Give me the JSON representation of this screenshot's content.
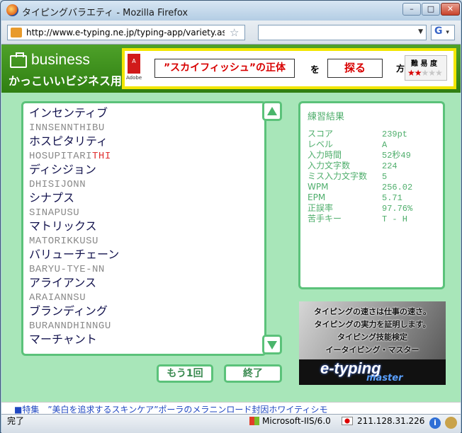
{
  "window": {
    "title": "タイピングバラエティ - Mozilla Firefox",
    "min": "–",
    "max": "□",
    "close": "✕"
  },
  "nav": {
    "url": "http://www.e-typing.ne.jp/typing-app/variety.asp",
    "star": "☆",
    "search_value": "",
    "search_engine": "G"
  },
  "banner": {
    "title": "business",
    "subtitle": "かっこいいビジネス用語",
    "ad": {
      "brand": "Adobe",
      "brand_mark": "A",
      "phrase": "”スカイフィッシュ”の正体",
      "particle": "を",
      "action": "探る",
      "method": "方法",
      "difficulty_label": "難 易 度",
      "stars_on": "★★",
      "stars_off": "★★★"
    }
  },
  "words": [
    {
      "kana": "インセンティブ",
      "roma": "INNSENNTHIBU",
      "err": ""
    },
    {
      "kana": "ホスピタリティ",
      "roma": "HOSUPITARI",
      "err": "THI"
    },
    {
      "kana": "ディシジョン",
      "roma": "DHISIJONN",
      "err": ""
    },
    {
      "kana": "シナプス",
      "roma": "SINAPUSU",
      "err": ""
    },
    {
      "kana": "マトリックス",
      "roma": "MATORIKKUSU",
      "err": ""
    },
    {
      "kana": "バリューチェーン",
      "roma": "BARYU-TYE-NN",
      "err": ""
    },
    {
      "kana": "アライアンス",
      "roma": "ARAIANNSU",
      "err": ""
    },
    {
      "kana": "ブランディング",
      "roma": "BURANNDHINNGU",
      "err": ""
    },
    {
      "kana": "マーチャント",
      "roma": "",
      "err": ""
    }
  ],
  "buttons": {
    "retry": "もう1回",
    "end": "終了"
  },
  "results": {
    "heading": "練習結果",
    "rows": [
      {
        "k": "スコア",
        "v": "239pt"
      },
      {
        "k": "レベル",
        "v": "A"
      },
      {
        "k": "入力時間",
        "v": "52秒49"
      },
      {
        "k": "入力文字数",
        "v": "224"
      },
      {
        "k": "ミス入力文字数",
        "v": "5"
      },
      {
        "k": "WPM",
        "v": "256.02"
      },
      {
        "k": "EPM",
        "v": "5.71"
      },
      {
        "k": "正誤率",
        "v": "97.76%"
      },
      {
        "k": "苦手キー",
        "v": "T - H"
      }
    ]
  },
  "promo": {
    "line1": "タイピングの速さは仕事の速さ。",
    "line2": "タイピングの実力を証明します。",
    "line3": "タイピング技能検定",
    "line4": "イータイピング・マスター",
    "logo": "e-typing",
    "logo_sub": "master"
  },
  "linkbar": {
    "text": "■特集　”美白を追求するスキンケア”ポーラのメラニンロード封因ホワイティシモ"
  },
  "status": {
    "text": "完了",
    "server": "Microsoft-IIS/6.0",
    "ip": "211.128.31.226",
    "info": "i"
  },
  "colors": {
    "accent_green": "#5bc27a",
    "page_bg": "#a8e6b9",
    "error_red": "#e03030",
    "banner_green": "#3a8c1a"
  }
}
